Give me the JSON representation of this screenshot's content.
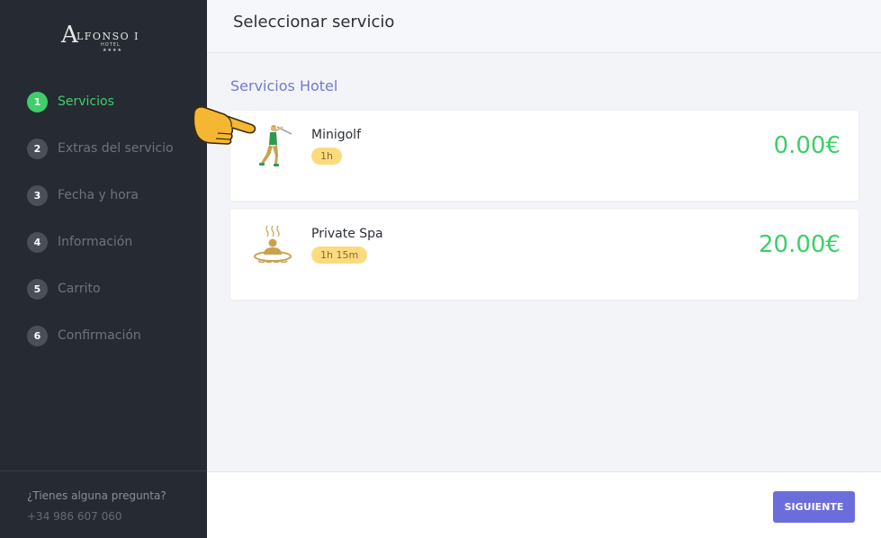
{
  "brand": {
    "logo_initial": "A",
    "logo_rest": "LFONSO I",
    "logo_sub": "HOTEL",
    "logo_stars": "★★★★"
  },
  "sidebar": {
    "steps": [
      {
        "number": "1",
        "label": "Servicios",
        "active": true
      },
      {
        "number": "2",
        "label": "Extras del servicio",
        "active": false
      },
      {
        "number": "3",
        "label": "Fecha y hora",
        "active": false
      },
      {
        "number": "4",
        "label": "Información",
        "active": false
      },
      {
        "number": "5",
        "label": "Carrito",
        "active": false
      },
      {
        "number": "6",
        "label": "Confirmación",
        "active": false
      }
    ],
    "footer": {
      "question": "¿Tienes alguna pregunta?",
      "phone": "+34 986 607 060"
    }
  },
  "header": {
    "title": "Seleccionar servicio"
  },
  "main": {
    "section_title": "Servicios Hotel",
    "services": [
      {
        "name": "Minigolf",
        "duration": "1h",
        "price": "0.00€",
        "icon": "golfer-icon"
      },
      {
        "name": "Private Spa",
        "duration": "1h 15m",
        "price": "20.00€",
        "icon": "spa-icon"
      }
    ]
  },
  "footer": {
    "next_label": "SIGUIENTE"
  },
  "colors": {
    "sidebar_bg": "#262b33",
    "accent_green": "#3fce6a",
    "accent_purple": "#6c6ddc",
    "badge_yellow": "#fbdb7e"
  }
}
